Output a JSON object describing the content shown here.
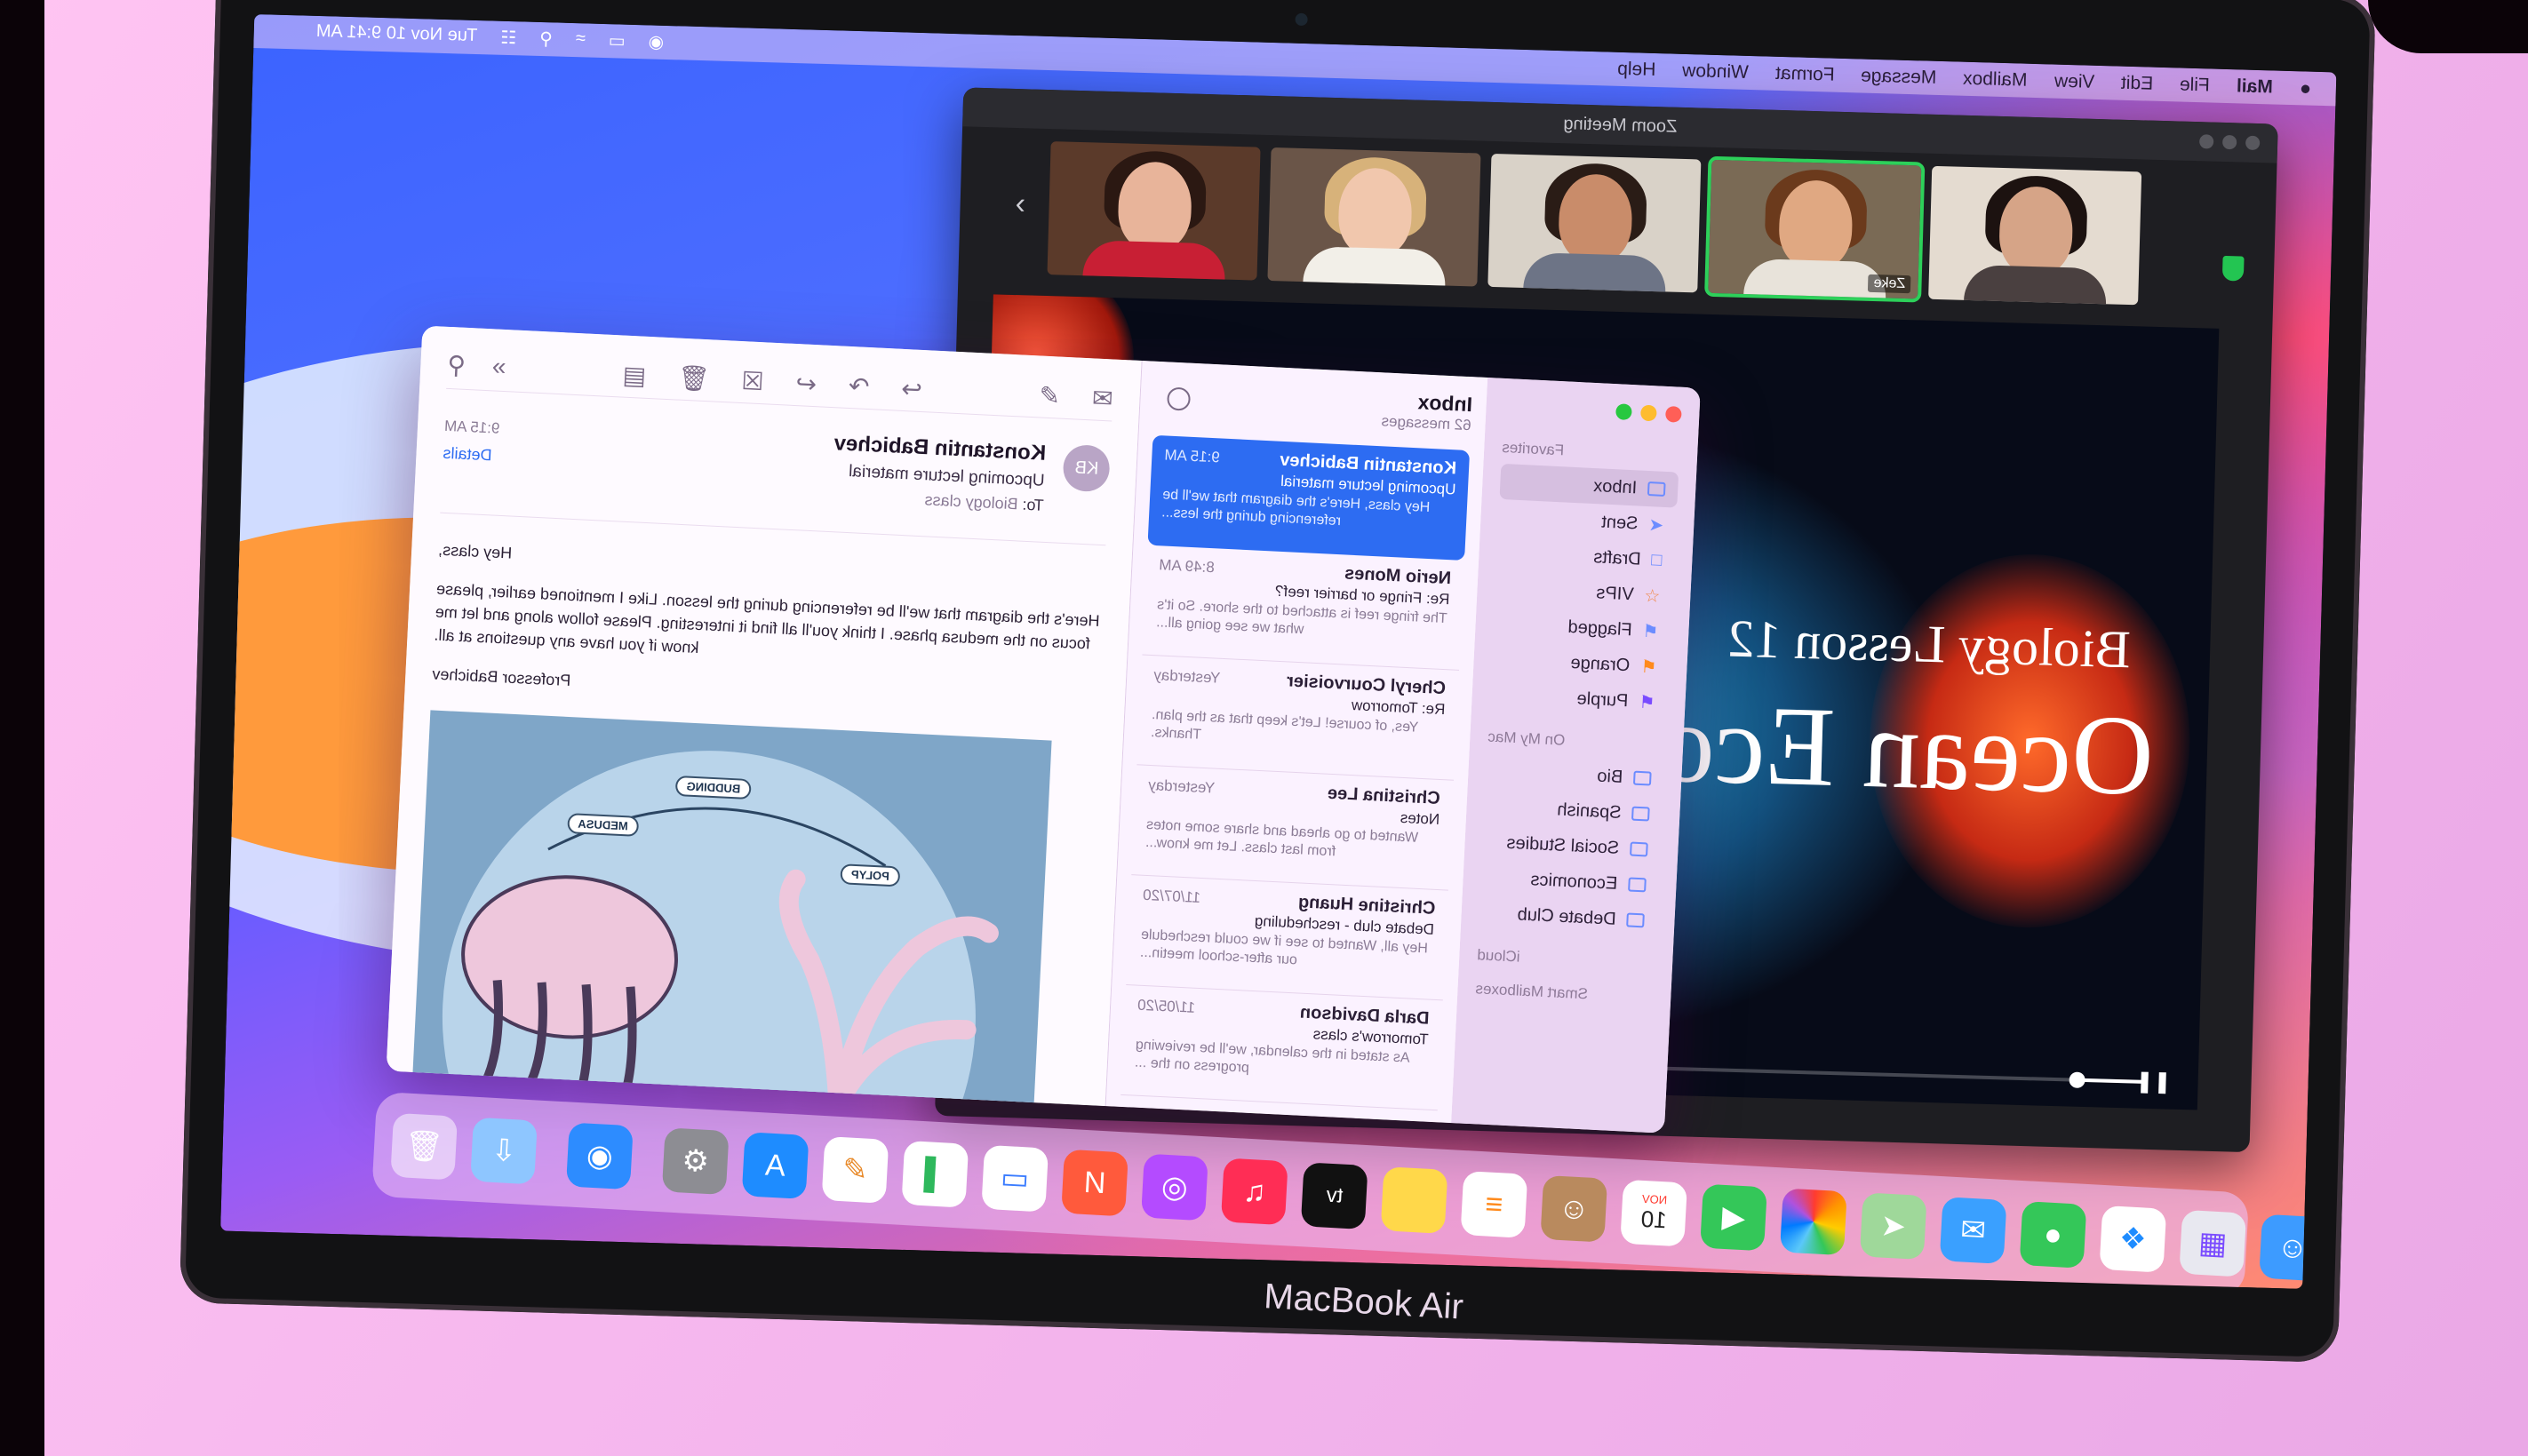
{
  "menubar": {
    "app_menu": [
      "Mail",
      "File",
      "Edit",
      "View",
      "Mailbox",
      "Message",
      "Format",
      "Window",
      "Help"
    ],
    "clock": "Tue Nov 10  9:41 AM"
  },
  "zoom": {
    "title": "Zoom Meeting",
    "participant_tag": "Zeke",
    "slide_subtitle": "Biology Lesson 12",
    "slide_title": "Ocean Eco",
    "playback_progress": 0.06
  },
  "mail": {
    "sidebar": {
      "favorites_label": "Favorites",
      "favorites": [
        {
          "label": "Inbox",
          "icon": "inbox-icon"
        },
        {
          "label": "Sent",
          "icon": "sent-icon"
        },
        {
          "label": "Drafts",
          "icon": "drafts-icon"
        },
        {
          "label": "VIPs",
          "icon": "star-icon"
        },
        {
          "label": "Flagged",
          "icon": "flag-icon"
        },
        {
          "label": "Orange",
          "icon": "flag-orange-icon"
        },
        {
          "label": "Purple",
          "icon": "flag-purple-icon"
        }
      ],
      "onmymac_label": "On My Mac",
      "onmymac": [
        "Bio",
        "Spanish",
        "Social Studies",
        "Economics",
        "Debate Club"
      ],
      "icloud_label": "iCloud",
      "smart_label": "Smart Mailboxes"
    },
    "list": {
      "title": "Inbox",
      "count": "62 messages",
      "messages": [
        {
          "from": "Konstantin Babichev",
          "time": "9:15 AM",
          "subject": "Upcoming lecture material",
          "preview": "Hey class, Here's the diagram that we'll be referencing during the less..."
        },
        {
          "from": "Nerio Mones",
          "time": "8:49 AM",
          "subject": "Re: Fringe or barrier reef?",
          "preview": "The fringe reef is attached to the shore. So it's what we see going all..."
        },
        {
          "from": "Cheryl Courvoisier",
          "time": "Yesterday",
          "subject": "Re: Tomorrow",
          "preview": "Yes, of course! Let's keep that as the plan. Thanks."
        },
        {
          "from": "Christina Lee",
          "time": "Yesterday",
          "subject": "Notes",
          "preview": "Wanted to go ahead and share some notes from last class. Let me know..."
        },
        {
          "from": "Christine Huang",
          "time": "11/07/20",
          "subject": "Debate club - rescheduling",
          "preview": "Hey all, Wanted to see if we could reschedule our after-school meetin..."
        },
        {
          "from": "Darla Davidson",
          "time": "11/05/20",
          "subject": "Tomorrow's class",
          "preview": "As stated in the calendar, we'll be reviewing progress on the ..."
        }
      ]
    },
    "message": {
      "avatar": "KB",
      "from": "Konstantin Babichev",
      "subject": "Upcoming lecture material",
      "to_label": "To:",
      "to": "Biology class",
      "time": "9:15 AM",
      "details": "Details",
      "greeting": "Hey class,",
      "body": "Here's the diagram that we'll be referencing during the lesson. Like I mentioned earlier, please focus on the medusa phase. I think you'll all find it interesting. Please follow along and let me know if you have any questions at all.",
      "signature": "Professor Babichev",
      "diagram_labels": {
        "budding": "BUDDING",
        "medusa": "MEDUSA",
        "polyp": "POLYP"
      }
    }
  },
  "dock": {
    "calendar_month": "NOV",
    "calendar_day": "10",
    "tv_label": "tv"
  },
  "laptop_brand": "MacBook Air"
}
